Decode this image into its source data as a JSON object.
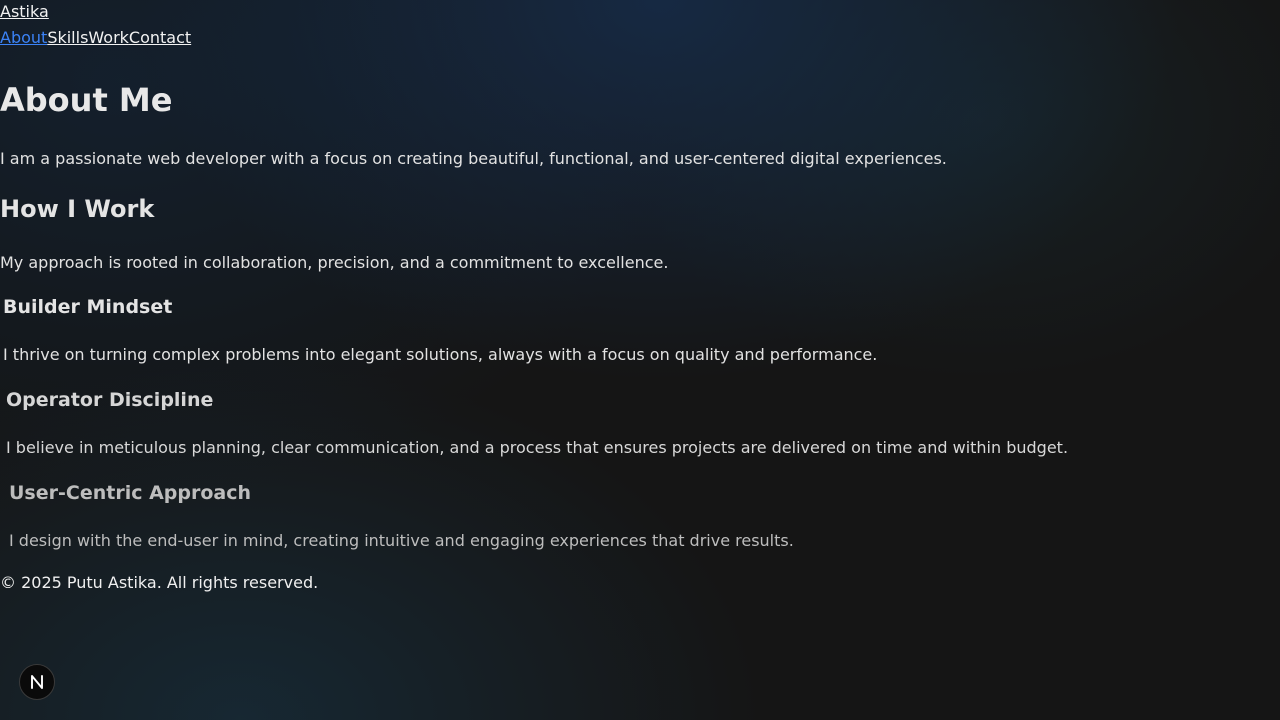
{
  "brand": {
    "name": "Astika"
  },
  "nav": {
    "items": [
      {
        "label": "About",
        "active": true
      },
      {
        "label": "Skills",
        "active": false
      },
      {
        "label": "Work",
        "active": false
      },
      {
        "label": "Contact",
        "active": false
      }
    ]
  },
  "about": {
    "title": "About Me",
    "description": "I am a passionate web developer with a focus on creating beautiful, functional, and user-centered digital experiences."
  },
  "how_i_work": {
    "title": "How I Work",
    "description": "My approach is rooted in collaboration, precision, and a commitment to excellence.",
    "cards": [
      {
        "title": "Builder Mindset",
        "description": "I thrive on turning complex problems into elegant solutions, always with a focus on quality and performance."
      },
      {
        "title": "Operator Discipline",
        "description": "I believe in meticulous planning, clear communication, and a process that ensures projects are delivered on time and within budget."
      },
      {
        "title": "User-Centric Approach",
        "description": "I design with the end-user in mind, creating intuitive and engaging experiences that drive results."
      }
    ]
  },
  "footer": {
    "text": "© 2025 Putu Astika. All rights reserved."
  },
  "dev_badge": {
    "icon": "nextjs-n-icon",
    "letter": "N"
  },
  "colors": {
    "accent": "#3b82f6",
    "background": "#151515",
    "text": "#e6e6e6"
  }
}
